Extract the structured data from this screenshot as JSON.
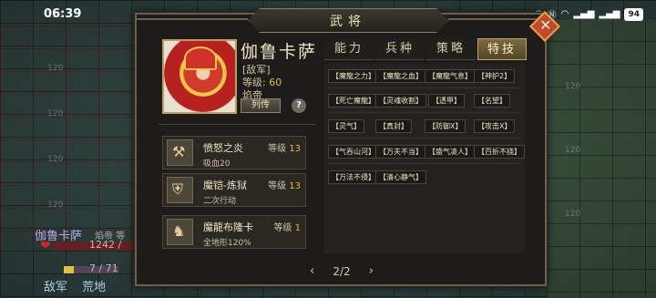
{
  "status_bar": {
    "time": "06:39",
    "battery": "94"
  },
  "map_tile_label": "120",
  "unit_info": {
    "name": "伽鲁卡萨",
    "class_short": "焰帝 等",
    "hp_text": "1242 /",
    "mp_text": "7 / 71",
    "tags": [
      "敌军",
      "荒地"
    ]
  },
  "panel": {
    "title": "武将",
    "hero": {
      "name": "伽鲁卡萨",
      "faction": "[敌军]",
      "level_label": "等级:",
      "level_value": "60",
      "class": "焰帝",
      "bio_button": "列传",
      "help_button": "?"
    },
    "equipment": [
      {
        "name": "愤怒之炎",
        "level_label": "等级",
        "level": "13",
        "effect": "吸血20",
        "icon": "axe-icon"
      },
      {
        "name": "魔铠-炼狱",
        "level_label": "等级",
        "level": "13",
        "effect": "二次行动",
        "icon": "armor-icon"
      },
      {
        "name": "魔龍布隆卡",
        "level_label": "等级",
        "level": "1",
        "effect": "全地形120%",
        "icon": "dragon-mount-icon"
      }
    ],
    "tabs": [
      {
        "label": "能力",
        "active": false
      },
      {
        "label": "兵种",
        "active": false
      },
      {
        "label": "策略",
        "active": false
      },
      {
        "label": "特技",
        "active": true
      }
    ],
    "skills": [
      [
        "【魔龍之力】",
        "【魔龍之血】",
        "【魔龍气息】",
        "【神护2】"
      ],
      [
        "【死亡魔龍】",
        "【灵魂收割】",
        "【透甲】",
        "【名望】"
      ],
      [
        "【灵气】",
        "【真封】",
        "【防御X】",
        "【攻击X】"
      ],
      [
        "【气吞山河】",
        "【万夫不当】",
        "【盛气凌人】",
        "【百折不挠】"
      ],
      [
        "【万法不侵】",
        "【清心静气】"
      ]
    ],
    "pager": {
      "prev": "‹",
      "text": "2/2",
      "next": "›"
    }
  },
  "colors": {
    "accent_gold": "#e7b84a",
    "panel_bg": "#1d1c1a",
    "close_button": "#c14a2b"
  }
}
